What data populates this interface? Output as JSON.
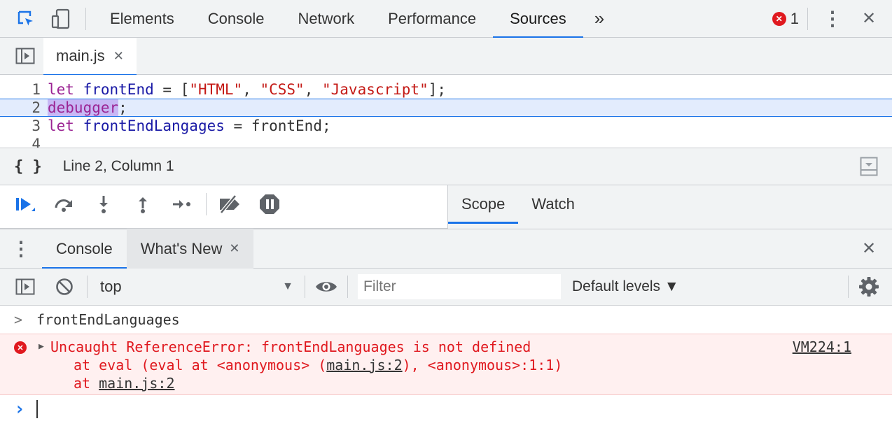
{
  "topbar": {
    "tabs": [
      {
        "label": "Elements"
      },
      {
        "label": "Console"
      },
      {
        "label": "Network"
      },
      {
        "label": "Performance"
      },
      {
        "label": "Sources"
      }
    ],
    "active_tab": "Sources",
    "more_tabs_glyph": "»",
    "error_count": "1",
    "error_glyph": "✕",
    "menu_glyph": "⋮",
    "close_glyph": "✕"
  },
  "filebar": {
    "file_name": "main.js",
    "close_glyph": "✕"
  },
  "editor": {
    "active_line": 2,
    "lines": [
      {
        "num": "1"
      },
      {
        "num": "2"
      },
      {
        "num": "3"
      },
      {
        "num": "4"
      }
    ],
    "tokens": {
      "l1_kw": "let",
      "l1_var": "frontEnd",
      "l1_eq": " = [",
      "l1_s1": "\"HTML\"",
      "l1_c1": ", ",
      "l1_s2": "\"CSS\"",
      "l1_c2": ", ",
      "l1_s3": "\"Javascript\"",
      "l1_end": "];",
      "l2_sel": "debugger",
      "l2_end": ";",
      "l3_kw": "let",
      "l3_var": "frontEndLangages",
      "l3_rest": " = frontEnd;"
    }
  },
  "statusbar": {
    "pretty_print_glyph": "{ }",
    "position": "Line 2, Column 1"
  },
  "debugger": {
    "side_tabs": [
      {
        "label": "Scope"
      },
      {
        "label": "Watch"
      }
    ],
    "active_side_tab": "Scope"
  },
  "drawer": {
    "menu_glyph": "⋮",
    "tabs": [
      {
        "label": "Console"
      },
      {
        "label": "What's New"
      }
    ],
    "tab_close_glyph": "✕",
    "close_glyph": "✕"
  },
  "console_toolbar": {
    "context": "top",
    "context_arrow": "▼",
    "filter_placeholder": "Filter",
    "levels": "Default levels ▼"
  },
  "console": {
    "input_prompt": ">",
    "input_text": "frontEndLanguages",
    "error": {
      "expand_glyph": "▶",
      "message": "Uncaught ReferenceError: frontEndLanguages is not defined",
      "source": "VM224:1",
      "stack1_pre": "at eval (eval at <anonymous> (",
      "stack1_link": "main.js:2",
      "stack1_post": "), <anonymous>:1:1)",
      "stack2_pre": "at ",
      "stack2_link": "main.js:2"
    },
    "prompt_glyph": "›"
  },
  "colors": {
    "accent": "#1a73e8",
    "error": "#e0191f",
    "error_bg": "#fff0f0"
  }
}
